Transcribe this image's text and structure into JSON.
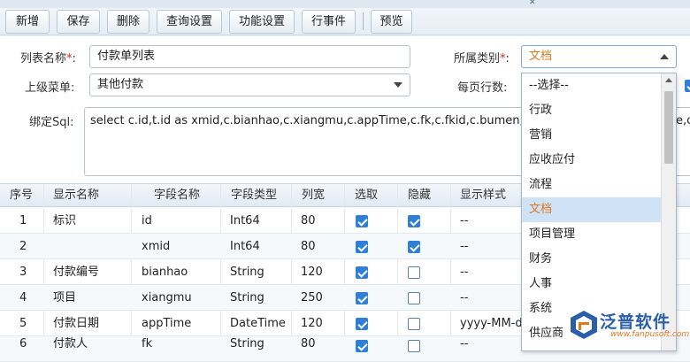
{
  "toolbar": {
    "buttons": [
      "新增",
      "保存",
      "删除",
      "查询设置",
      "功能设置",
      "行事件",
      "预览"
    ]
  },
  "form": {
    "list_name_label": "列表名称",
    "list_name_value": "付款单列表",
    "parent_menu_label": "上级菜单:",
    "parent_menu_value": "其他付款",
    "category_label": "所属类别",
    "category_value": "文档",
    "rows_per_page_label": "每页行数:",
    "sql_label": "绑定Sql:",
    "sql_value": "select c.id,t.id as xmid,c.bianhao,c.xiangmu,c.appTime,c.fk,c.fkid,c.bumen,c.bumenid",
    "sql_tail": "e,c.",
    "required_mark": "*",
    "colon": ":"
  },
  "grid": {
    "headers": [
      "序号",
      "显示名称",
      "字段名称",
      "字段类型",
      "列宽",
      "选取",
      "隐藏",
      "显示样式"
    ],
    "rows": [
      {
        "no": "1",
        "display": "标识",
        "field": "id",
        "type": "Int64",
        "width": "80",
        "selected": true,
        "hidden": true,
        "style": "--"
      },
      {
        "no": "2",
        "display": "",
        "field": "xmid",
        "type": "Int64",
        "width": "80",
        "selected": true,
        "hidden": true,
        "style": "--"
      },
      {
        "no": "3",
        "display": "付款编号",
        "field": "bianhao",
        "type": "String",
        "width": "120",
        "selected": true,
        "hidden": false,
        "style": "--"
      },
      {
        "no": "4",
        "display": "项目",
        "field": "xiangmu",
        "type": "String",
        "width": "250",
        "selected": true,
        "hidden": false,
        "style": "--"
      },
      {
        "no": "5",
        "display": "付款日期",
        "field": "appTime",
        "type": "DateTime",
        "width": "120",
        "selected": true,
        "hidden": false,
        "style": "yyyy-MM-dd"
      },
      {
        "no": "6",
        "display": "付款人",
        "field": "fk",
        "type": "String",
        "width": "80",
        "selected": true,
        "hidden": false,
        "style": "--"
      }
    ],
    "row6_align": "居中"
  },
  "dropdown": {
    "options": [
      "--选择--",
      "行政",
      "营销",
      "应收应付",
      "流程",
      "文档",
      "项目管理",
      "财务",
      "人事",
      "系统",
      "供应商"
    ],
    "selected_index": 5
  },
  "logo": {
    "name": "泛普软件",
    "url": "www.fanpusoft.com"
  },
  "colors": {
    "accent_blue": "#2f7fd6",
    "selected_text_orange": "#e07820",
    "logo_blue": "#2a5fa8"
  }
}
